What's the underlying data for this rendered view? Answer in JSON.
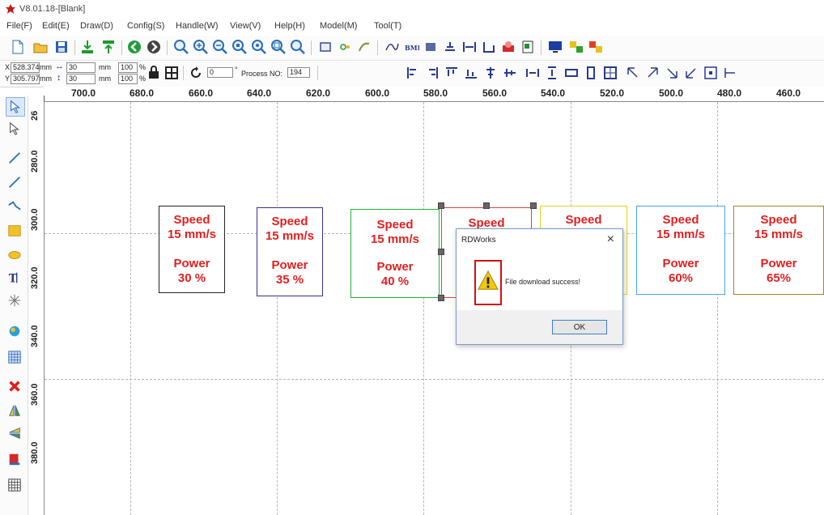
{
  "window": {
    "title": "V8.01.18-[Blank]"
  },
  "menu": [
    "File(F)",
    "Edit(E)",
    "Draw(D)",
    "Config(S)",
    "Handle(W)",
    "View(V)",
    "Help(H)",
    "Model(M)",
    "Tool(T)"
  ],
  "toolbar": {
    "x_value": "528.374",
    "y_value": "305.797",
    "width_value": "30",
    "height_value": "30",
    "unit_mm": "mm",
    "scale_x": "100",
    "scale_y": "100",
    "percent": "%",
    "x_label": "X",
    "y_label": "Y",
    "rotate_value": "0",
    "degree_symbol": "°",
    "process_label": "Process NO:",
    "process_value": "194"
  },
  "ruler": {
    "top_labels": [
      "700.0",
      "680.0",
      "660.0",
      "640.0",
      "620.0",
      "600.0",
      "580.0",
      "560.0",
      "540.0",
      "520.0",
      "500.0",
      "480.0",
      "460.0"
    ],
    "left_labels": [
      "26",
      "280.0",
      "300.0",
      "320.0",
      "340.0",
      "360.0",
      "380.0"
    ]
  },
  "cards": [
    {
      "l1": "Speed",
      "l2": "15 mm/s",
      "l3": "Power",
      "l4": "30 %",
      "border": "#222222"
    },
    {
      "l1": "Speed",
      "l2": "15 mm/s",
      "l3": "Power",
      "l4": "35 %",
      "border": "#3a2f9a"
    },
    {
      "l1": "Speed",
      "l2": "15 mm/s",
      "l3": "Power",
      "l4": "40 %",
      "border": "#22b23a"
    },
    {
      "l1": "Speed",
      "l2": "",
      "l3": "",
      "l4": "",
      "border": "#e04040"
    },
    {
      "l1": "Speed",
      "l2": "",
      "l3": "",
      "l4": "",
      "border": "#e6d21a"
    },
    {
      "l1": "Speed",
      "l2": "15 mm/s",
      "l3": "Power",
      "l4": "60%",
      "border": "#4aa8e0"
    },
    {
      "l1": "Speed",
      "l2": "15 mm/s",
      "l3": "Power",
      "l4": "65%",
      "border": "#9a8a2a"
    }
  ],
  "dialog": {
    "title": "RDWorks",
    "close": "×",
    "message": "File download success!",
    "ok_label": "OK"
  },
  "colors": {
    "text_red": "#e02020",
    "accent_blue": "#3c7fd1"
  }
}
